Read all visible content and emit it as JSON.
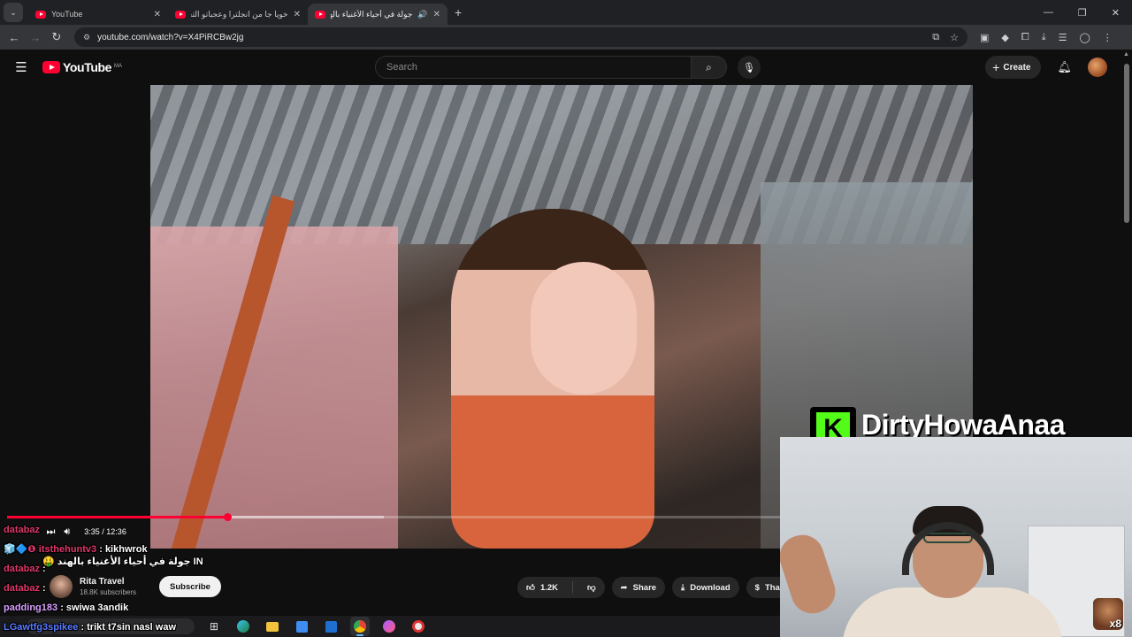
{
  "browser": {
    "tabs": [
      {
        "title": "YouTube",
        "active": false,
        "audio": false
      },
      {
        "title": "خويا جا من انجلترا وعجباتو التجربة",
        "active": false,
        "audio": false
      },
      {
        "title": "جولة في أحياء الأغنياء بالهند 🤑",
        "active": true,
        "audio": true
      }
    ],
    "url": "youtube.com/watch?v=X4PiRCBw2jg"
  },
  "youtube": {
    "logo_text": "YouTube",
    "country_code": "MA",
    "search_placeholder": "Search",
    "create_label": "Create"
  },
  "player": {
    "time_display": "3:35 / 12:36",
    "progress_fraction": 0.2844,
    "buffer_fraction": 0.4875
  },
  "video_info": {
    "channel_name": "Rita Travel",
    "subscribers": "18.8K subscribers",
    "subscribe_label": "Subscribe",
    "like_count": "1.2K",
    "share_label": "Share",
    "download_label": "Download",
    "thanks_label": "Thank"
  },
  "chat": {
    "messages": [
      {
        "user": "databaz",
        "text": "",
        "user_color": "pink"
      },
      {
        "user": "🧊🔷❶ itsthehuntv3",
        "text": ": kikhwrok",
        "user_color": "pink"
      },
      {
        "user": "",
        "text": "🤑 جولة في أحياء الأغنياء بالهند IN",
        "user_color": "pink"
      },
      {
        "user": "databaz",
        "text": ":",
        "user_color": "pink"
      },
      {
        "user": "databaz",
        "text": ":",
        "user_color": "pink"
      },
      {
        "user": "padding183",
        "text": ": swiwa 3andik",
        "user_color": "purple"
      },
      {
        "user": "LGawtfg3spikee",
        "text": ": trikt t7sin nasl waw",
        "user_color": "blue"
      }
    ]
  },
  "stream_overlay": {
    "kick_letter": "K",
    "streamer_name": "DirtyHowaAnaa",
    "emote_count": "x8"
  }
}
